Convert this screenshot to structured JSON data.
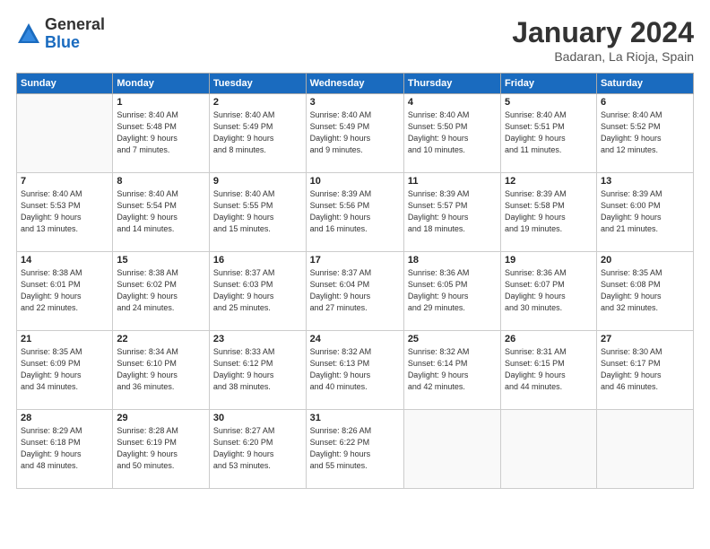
{
  "header": {
    "logo": {
      "general": "General",
      "blue": "Blue"
    },
    "title": "January 2024",
    "subtitle": "Badaran, La Rioja, Spain"
  },
  "calendar": {
    "days_of_week": [
      "Sunday",
      "Monday",
      "Tuesday",
      "Wednesday",
      "Thursday",
      "Friday",
      "Saturday"
    ],
    "weeks": [
      [
        {
          "day": "",
          "info": ""
        },
        {
          "day": "1",
          "info": "Sunrise: 8:40 AM\nSunset: 5:48 PM\nDaylight: 9 hours\nand 7 minutes."
        },
        {
          "day": "2",
          "info": "Sunrise: 8:40 AM\nSunset: 5:49 PM\nDaylight: 9 hours\nand 8 minutes."
        },
        {
          "day": "3",
          "info": "Sunrise: 8:40 AM\nSunset: 5:49 PM\nDaylight: 9 hours\nand 9 minutes."
        },
        {
          "day": "4",
          "info": "Sunrise: 8:40 AM\nSunset: 5:50 PM\nDaylight: 9 hours\nand 10 minutes."
        },
        {
          "day": "5",
          "info": "Sunrise: 8:40 AM\nSunset: 5:51 PM\nDaylight: 9 hours\nand 11 minutes."
        },
        {
          "day": "6",
          "info": "Sunrise: 8:40 AM\nSunset: 5:52 PM\nDaylight: 9 hours\nand 12 minutes."
        }
      ],
      [
        {
          "day": "7",
          "info": "Sunrise: 8:40 AM\nSunset: 5:53 PM\nDaylight: 9 hours\nand 13 minutes."
        },
        {
          "day": "8",
          "info": "Sunrise: 8:40 AM\nSunset: 5:54 PM\nDaylight: 9 hours\nand 14 minutes."
        },
        {
          "day": "9",
          "info": "Sunrise: 8:40 AM\nSunset: 5:55 PM\nDaylight: 9 hours\nand 15 minutes."
        },
        {
          "day": "10",
          "info": "Sunrise: 8:39 AM\nSunset: 5:56 PM\nDaylight: 9 hours\nand 16 minutes."
        },
        {
          "day": "11",
          "info": "Sunrise: 8:39 AM\nSunset: 5:57 PM\nDaylight: 9 hours\nand 18 minutes."
        },
        {
          "day": "12",
          "info": "Sunrise: 8:39 AM\nSunset: 5:58 PM\nDaylight: 9 hours\nand 19 minutes."
        },
        {
          "day": "13",
          "info": "Sunrise: 8:39 AM\nSunset: 6:00 PM\nDaylight: 9 hours\nand 21 minutes."
        }
      ],
      [
        {
          "day": "14",
          "info": "Sunrise: 8:38 AM\nSunset: 6:01 PM\nDaylight: 9 hours\nand 22 minutes."
        },
        {
          "day": "15",
          "info": "Sunrise: 8:38 AM\nSunset: 6:02 PM\nDaylight: 9 hours\nand 24 minutes."
        },
        {
          "day": "16",
          "info": "Sunrise: 8:37 AM\nSunset: 6:03 PM\nDaylight: 9 hours\nand 25 minutes."
        },
        {
          "day": "17",
          "info": "Sunrise: 8:37 AM\nSunset: 6:04 PM\nDaylight: 9 hours\nand 27 minutes."
        },
        {
          "day": "18",
          "info": "Sunrise: 8:36 AM\nSunset: 6:05 PM\nDaylight: 9 hours\nand 29 minutes."
        },
        {
          "day": "19",
          "info": "Sunrise: 8:36 AM\nSunset: 6:07 PM\nDaylight: 9 hours\nand 30 minutes."
        },
        {
          "day": "20",
          "info": "Sunrise: 8:35 AM\nSunset: 6:08 PM\nDaylight: 9 hours\nand 32 minutes."
        }
      ],
      [
        {
          "day": "21",
          "info": "Sunrise: 8:35 AM\nSunset: 6:09 PM\nDaylight: 9 hours\nand 34 minutes."
        },
        {
          "day": "22",
          "info": "Sunrise: 8:34 AM\nSunset: 6:10 PM\nDaylight: 9 hours\nand 36 minutes."
        },
        {
          "day": "23",
          "info": "Sunrise: 8:33 AM\nSunset: 6:12 PM\nDaylight: 9 hours\nand 38 minutes."
        },
        {
          "day": "24",
          "info": "Sunrise: 8:32 AM\nSunset: 6:13 PM\nDaylight: 9 hours\nand 40 minutes."
        },
        {
          "day": "25",
          "info": "Sunrise: 8:32 AM\nSunset: 6:14 PM\nDaylight: 9 hours\nand 42 minutes."
        },
        {
          "day": "26",
          "info": "Sunrise: 8:31 AM\nSunset: 6:15 PM\nDaylight: 9 hours\nand 44 minutes."
        },
        {
          "day": "27",
          "info": "Sunrise: 8:30 AM\nSunset: 6:17 PM\nDaylight: 9 hours\nand 46 minutes."
        }
      ],
      [
        {
          "day": "28",
          "info": "Sunrise: 8:29 AM\nSunset: 6:18 PM\nDaylight: 9 hours\nand 48 minutes."
        },
        {
          "day": "29",
          "info": "Sunrise: 8:28 AM\nSunset: 6:19 PM\nDaylight: 9 hours\nand 50 minutes."
        },
        {
          "day": "30",
          "info": "Sunrise: 8:27 AM\nSunset: 6:20 PM\nDaylight: 9 hours\nand 53 minutes."
        },
        {
          "day": "31",
          "info": "Sunrise: 8:26 AM\nSunset: 6:22 PM\nDaylight: 9 hours\nand 55 minutes."
        },
        {
          "day": "",
          "info": ""
        },
        {
          "day": "",
          "info": ""
        },
        {
          "day": "",
          "info": ""
        }
      ]
    ]
  }
}
